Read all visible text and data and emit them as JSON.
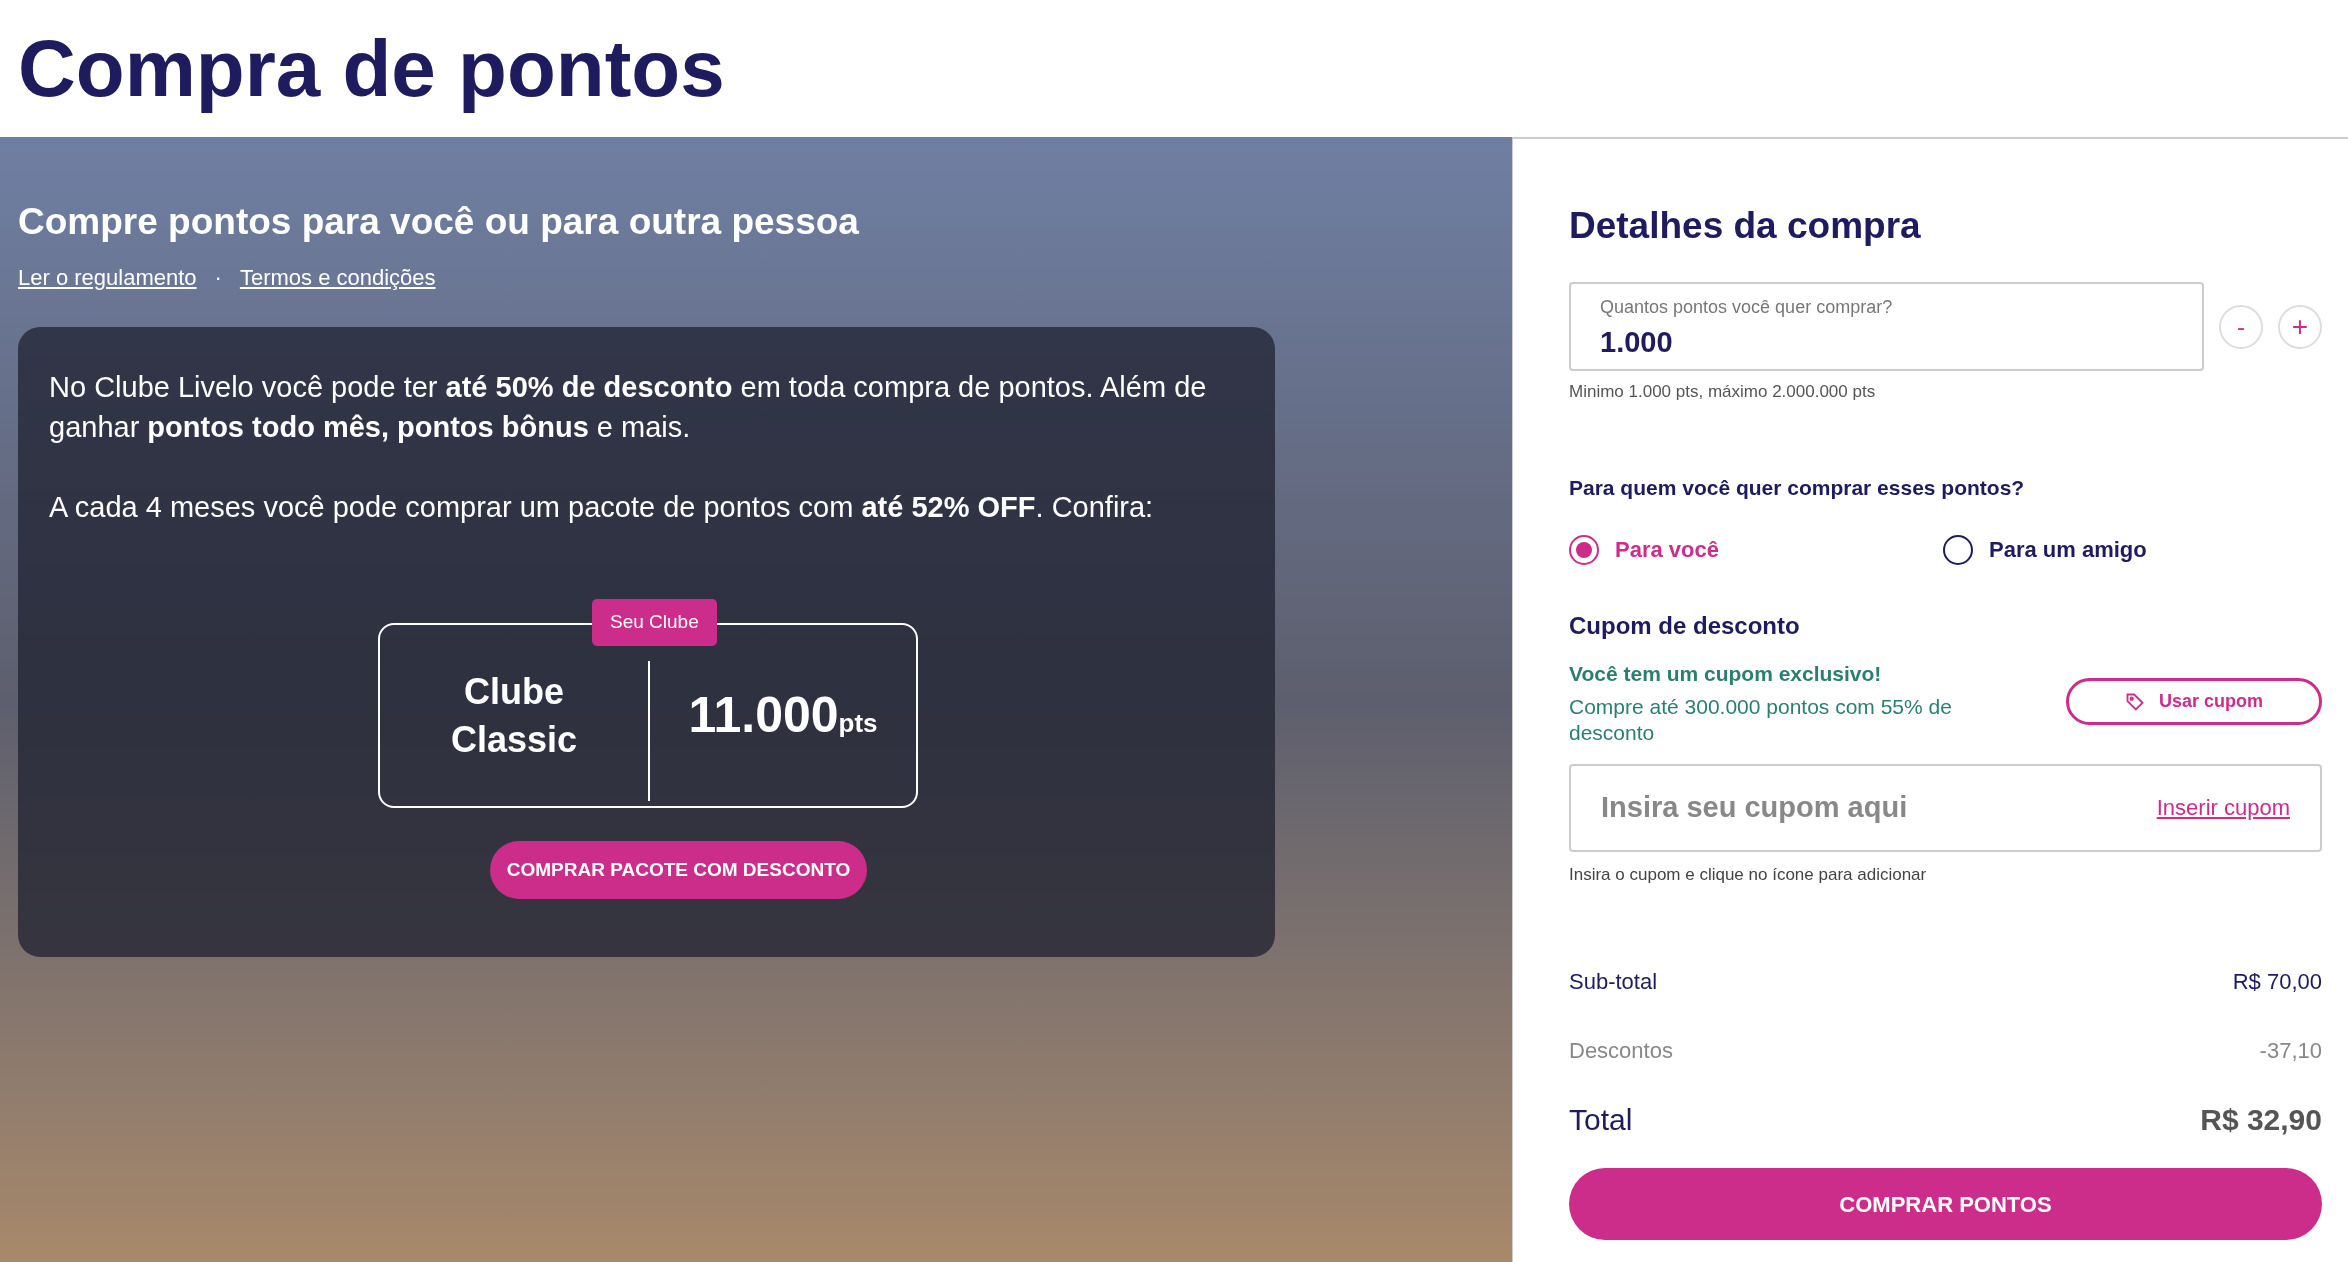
{
  "page_title": "Compra de pontos",
  "hero": {
    "heading": "Compre pontos para você ou para outra pessoa",
    "links": [
      "Ler o regulamento",
      "Termos e condições"
    ],
    "separator": "·",
    "card": {
      "paragraphs": [
        "No Clube Livelo você pode ter **até 50% de desconto** em toda compra de pontos. Além de ganhar **pontos todo mês, pontos bônus** e mais.",
        "A cada 4 meses você pode comprar um pacote de pontos com **até 52% OFF**. Confira:"
      ],
      "club": {
        "badge": "Seu Clube",
        "name": "Clube Classic",
        "points": "11.000",
        "unit": "pts"
      },
      "button": "COMPRAR PACOTE COM DESCONTO"
    }
  },
  "details": {
    "title": "Detalhes da compra",
    "quantity": {
      "label": "Quantos pontos você quer comprar?",
      "value": "1.000",
      "decrement": "-",
      "increment": "+",
      "hint": "Minimo 1.000 pts, máximo 2.000.000 pts"
    },
    "recipient": {
      "question": "Para quem você quer comprar esses pontos?",
      "options": [
        {
          "label": "Para você",
          "selected": true
        },
        {
          "label": "Para um amigo",
          "selected": false
        }
      ]
    },
    "coupon": {
      "title": "Cupom de desconto",
      "offer_title": "Você tem um cupom exclusivo!",
      "offer_text": "Compre até 300.000 pontos com 55% de desconto",
      "use_button": "Usar cupom",
      "placeholder": "Insira seu cupom aqui",
      "apply_link": "Inserir cupom",
      "hint": "Insira o cupom e clique no ícone para adicionar"
    },
    "summary": [
      {
        "kind": "subtotal",
        "label": "Sub-total",
        "value": "R$ 70,00"
      },
      {
        "kind": "discount",
        "label": "Descontos",
        "value": "-37,10"
      },
      {
        "kind": "total",
        "label": "Total",
        "value": "R$ 32,90"
      }
    ],
    "buy_button": "COMPRAR PONTOS"
  }
}
